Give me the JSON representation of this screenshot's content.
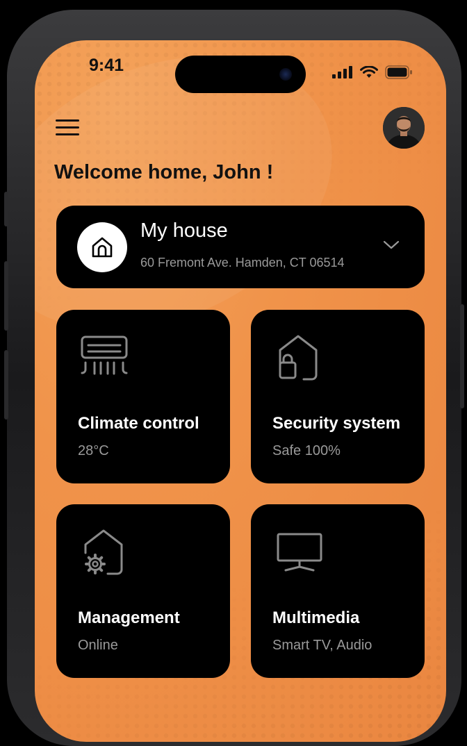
{
  "status_bar": {
    "time": "9:41"
  },
  "header": {
    "menu_icon": "hamburger-menu-icon",
    "avatar": "user-avatar",
    "welcome_text": "Welcome home, John !"
  },
  "house_selector": {
    "name": "My house",
    "address": "60 Fremont Ave. Hamden, CT 06514",
    "icon": "home-icon",
    "dropdown_icon": "chevron-down-icon"
  },
  "tiles": [
    {
      "label": "Climate control",
      "status": "28°C",
      "icon": "air-conditioner-icon"
    },
    {
      "label": "Security system",
      "status": "Safe 100%",
      "icon": "house-lock-icon"
    },
    {
      "label": "Management",
      "status": "Online",
      "icon": "house-gear-icon"
    },
    {
      "label": "Multimedia",
      "status": "Smart TV, Audio",
      "icon": "tv-icon"
    }
  ],
  "colors": {
    "background_orange": "#f0934a",
    "card_black": "#000000",
    "secondary_text": "#9a9a9a",
    "icon_gray": "#8a8a8a"
  }
}
